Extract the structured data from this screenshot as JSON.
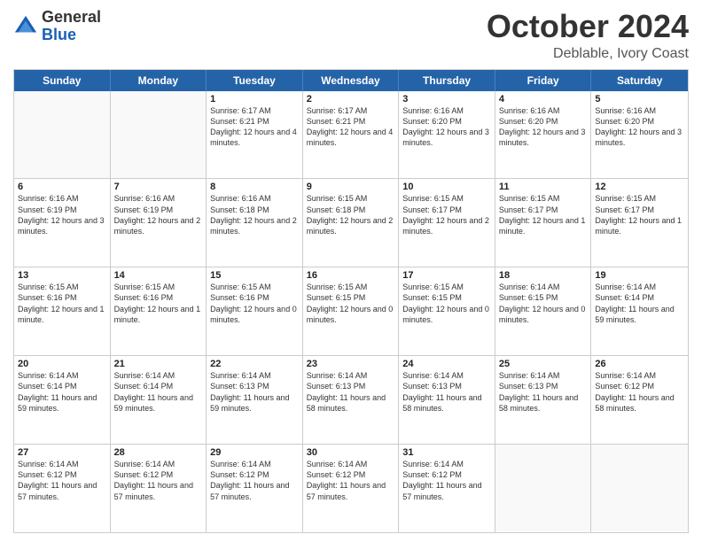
{
  "logo": {
    "general": "General",
    "blue": "Blue"
  },
  "header": {
    "month": "October 2024",
    "location": "Deblable, Ivory Coast"
  },
  "weekdays": [
    "Sunday",
    "Monday",
    "Tuesday",
    "Wednesday",
    "Thursday",
    "Friday",
    "Saturday"
  ],
  "rows": [
    [
      {
        "day": "",
        "info": ""
      },
      {
        "day": "",
        "info": ""
      },
      {
        "day": "1",
        "info": "Sunrise: 6:17 AM\nSunset: 6:21 PM\nDaylight: 12 hours and 4 minutes."
      },
      {
        "day": "2",
        "info": "Sunrise: 6:17 AM\nSunset: 6:21 PM\nDaylight: 12 hours and 4 minutes."
      },
      {
        "day": "3",
        "info": "Sunrise: 6:16 AM\nSunset: 6:20 PM\nDaylight: 12 hours and 3 minutes."
      },
      {
        "day": "4",
        "info": "Sunrise: 6:16 AM\nSunset: 6:20 PM\nDaylight: 12 hours and 3 minutes."
      },
      {
        "day": "5",
        "info": "Sunrise: 6:16 AM\nSunset: 6:20 PM\nDaylight: 12 hours and 3 minutes."
      }
    ],
    [
      {
        "day": "6",
        "info": "Sunrise: 6:16 AM\nSunset: 6:19 PM\nDaylight: 12 hours and 3 minutes."
      },
      {
        "day": "7",
        "info": "Sunrise: 6:16 AM\nSunset: 6:19 PM\nDaylight: 12 hours and 2 minutes."
      },
      {
        "day": "8",
        "info": "Sunrise: 6:16 AM\nSunset: 6:18 PM\nDaylight: 12 hours and 2 minutes."
      },
      {
        "day": "9",
        "info": "Sunrise: 6:15 AM\nSunset: 6:18 PM\nDaylight: 12 hours and 2 minutes."
      },
      {
        "day": "10",
        "info": "Sunrise: 6:15 AM\nSunset: 6:17 PM\nDaylight: 12 hours and 2 minutes."
      },
      {
        "day": "11",
        "info": "Sunrise: 6:15 AM\nSunset: 6:17 PM\nDaylight: 12 hours and 1 minute."
      },
      {
        "day": "12",
        "info": "Sunrise: 6:15 AM\nSunset: 6:17 PM\nDaylight: 12 hours and 1 minute."
      }
    ],
    [
      {
        "day": "13",
        "info": "Sunrise: 6:15 AM\nSunset: 6:16 PM\nDaylight: 12 hours and 1 minute."
      },
      {
        "day": "14",
        "info": "Sunrise: 6:15 AM\nSunset: 6:16 PM\nDaylight: 12 hours and 1 minute."
      },
      {
        "day": "15",
        "info": "Sunrise: 6:15 AM\nSunset: 6:16 PM\nDaylight: 12 hours and 0 minutes."
      },
      {
        "day": "16",
        "info": "Sunrise: 6:15 AM\nSunset: 6:15 PM\nDaylight: 12 hours and 0 minutes."
      },
      {
        "day": "17",
        "info": "Sunrise: 6:15 AM\nSunset: 6:15 PM\nDaylight: 12 hours and 0 minutes."
      },
      {
        "day": "18",
        "info": "Sunrise: 6:14 AM\nSunset: 6:15 PM\nDaylight: 12 hours and 0 minutes."
      },
      {
        "day": "19",
        "info": "Sunrise: 6:14 AM\nSunset: 6:14 PM\nDaylight: 11 hours and 59 minutes."
      }
    ],
    [
      {
        "day": "20",
        "info": "Sunrise: 6:14 AM\nSunset: 6:14 PM\nDaylight: 11 hours and 59 minutes."
      },
      {
        "day": "21",
        "info": "Sunrise: 6:14 AM\nSunset: 6:14 PM\nDaylight: 11 hours and 59 minutes."
      },
      {
        "day": "22",
        "info": "Sunrise: 6:14 AM\nSunset: 6:13 PM\nDaylight: 11 hours and 59 minutes."
      },
      {
        "day": "23",
        "info": "Sunrise: 6:14 AM\nSunset: 6:13 PM\nDaylight: 11 hours and 58 minutes."
      },
      {
        "day": "24",
        "info": "Sunrise: 6:14 AM\nSunset: 6:13 PM\nDaylight: 11 hours and 58 minutes."
      },
      {
        "day": "25",
        "info": "Sunrise: 6:14 AM\nSunset: 6:13 PM\nDaylight: 11 hours and 58 minutes."
      },
      {
        "day": "26",
        "info": "Sunrise: 6:14 AM\nSunset: 6:12 PM\nDaylight: 11 hours and 58 minutes."
      }
    ],
    [
      {
        "day": "27",
        "info": "Sunrise: 6:14 AM\nSunset: 6:12 PM\nDaylight: 11 hours and 57 minutes."
      },
      {
        "day": "28",
        "info": "Sunrise: 6:14 AM\nSunset: 6:12 PM\nDaylight: 11 hours and 57 minutes."
      },
      {
        "day": "29",
        "info": "Sunrise: 6:14 AM\nSunset: 6:12 PM\nDaylight: 11 hours and 57 minutes."
      },
      {
        "day": "30",
        "info": "Sunrise: 6:14 AM\nSunset: 6:12 PM\nDaylight: 11 hours and 57 minutes."
      },
      {
        "day": "31",
        "info": "Sunrise: 6:14 AM\nSunset: 6:12 PM\nDaylight: 11 hours and 57 minutes."
      },
      {
        "day": "",
        "info": ""
      },
      {
        "day": "",
        "info": ""
      }
    ]
  ]
}
